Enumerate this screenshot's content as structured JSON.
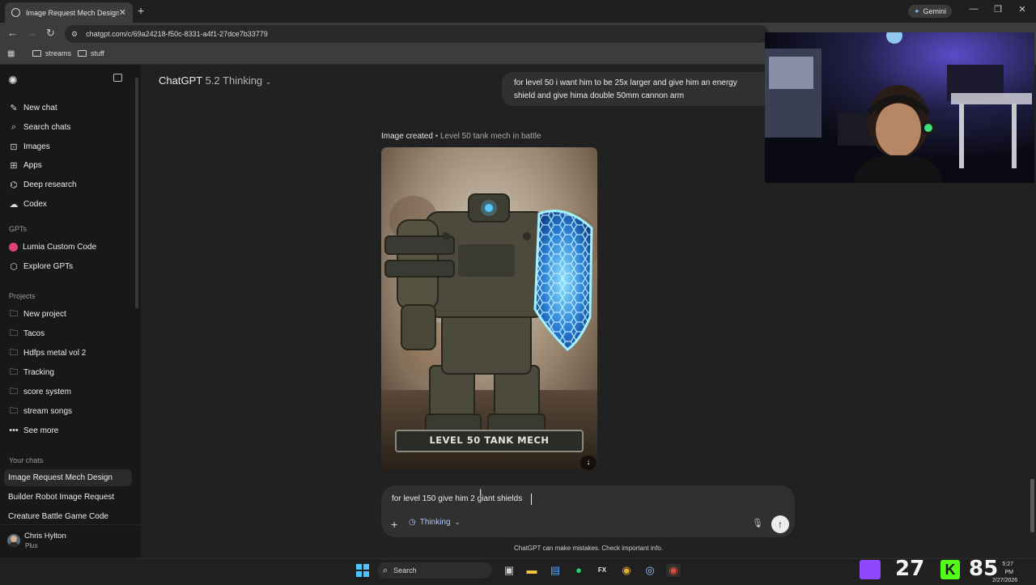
{
  "browser": {
    "tab_title": "Image Request Mech Design",
    "url": "chatgpt.com/c/69a24218-f50c-8331-a4f1-27dce7b33779",
    "gemini_label": "Gemini",
    "bookmarks": [
      "streams",
      "stuff"
    ]
  },
  "header": {
    "model": "ChatGPT",
    "version": "5.2 Thinking"
  },
  "sidebar": {
    "items": [
      {
        "label": "New chat",
        "icon": "edit-icon"
      },
      {
        "label": "Search chats",
        "icon": "search-icon"
      },
      {
        "label": "Images",
        "icon": "image-icon"
      },
      {
        "label": "Apps",
        "icon": "apps-icon"
      },
      {
        "label": "Deep research",
        "icon": "telescope-icon"
      },
      {
        "label": "Codex",
        "icon": "codex-icon"
      }
    ],
    "gpts_heading": "GPTs",
    "gpts": [
      {
        "label": "Lumia Custom Code",
        "icon": "lumia-icon"
      },
      {
        "label": "Explore GPTs",
        "icon": "explore-icon"
      }
    ],
    "projects_heading": "Projects",
    "projects": [
      {
        "label": "New project",
        "icon": "new-folder-icon"
      },
      {
        "label": "Tacos",
        "icon": "folder-icon"
      },
      {
        "label": "Hdfps metal vol 2",
        "icon": "folder-icon"
      },
      {
        "label": "Tracking",
        "icon": "folder-icon"
      },
      {
        "label": "score system",
        "icon": "folder-icon"
      },
      {
        "label": "stream songs",
        "icon": "folder-icon"
      },
      {
        "label": "See more",
        "icon": "more-icon"
      }
    ],
    "chats_heading": "Your chats",
    "chats": [
      "Image Request Mech Design",
      "Builder Robot Image Request",
      "Creature Battle Game Code"
    ],
    "user": {
      "name": "Chris Hylton",
      "plan": "Plus"
    }
  },
  "conversation": {
    "user_message": "for level 50 i want him to be 25x larger and give him an energy shield and give hima double 50mm cannon arm",
    "image_caption_status": "Image created",
    "image_caption_title": "Level 50 tank mech in battle",
    "image_banner": "LEVEL 50 TANK MECH"
  },
  "composer": {
    "text": "for level 150 give him 2 giant shields",
    "mode": "Thinking"
  },
  "disclaimer": "ChatGPT can make mistakes. Check important info.",
  "taskbar": {
    "search": "Search",
    "counter_left": "27",
    "counter_right": "85",
    "time": "5:27 PM",
    "date": "2/27/2026"
  }
}
